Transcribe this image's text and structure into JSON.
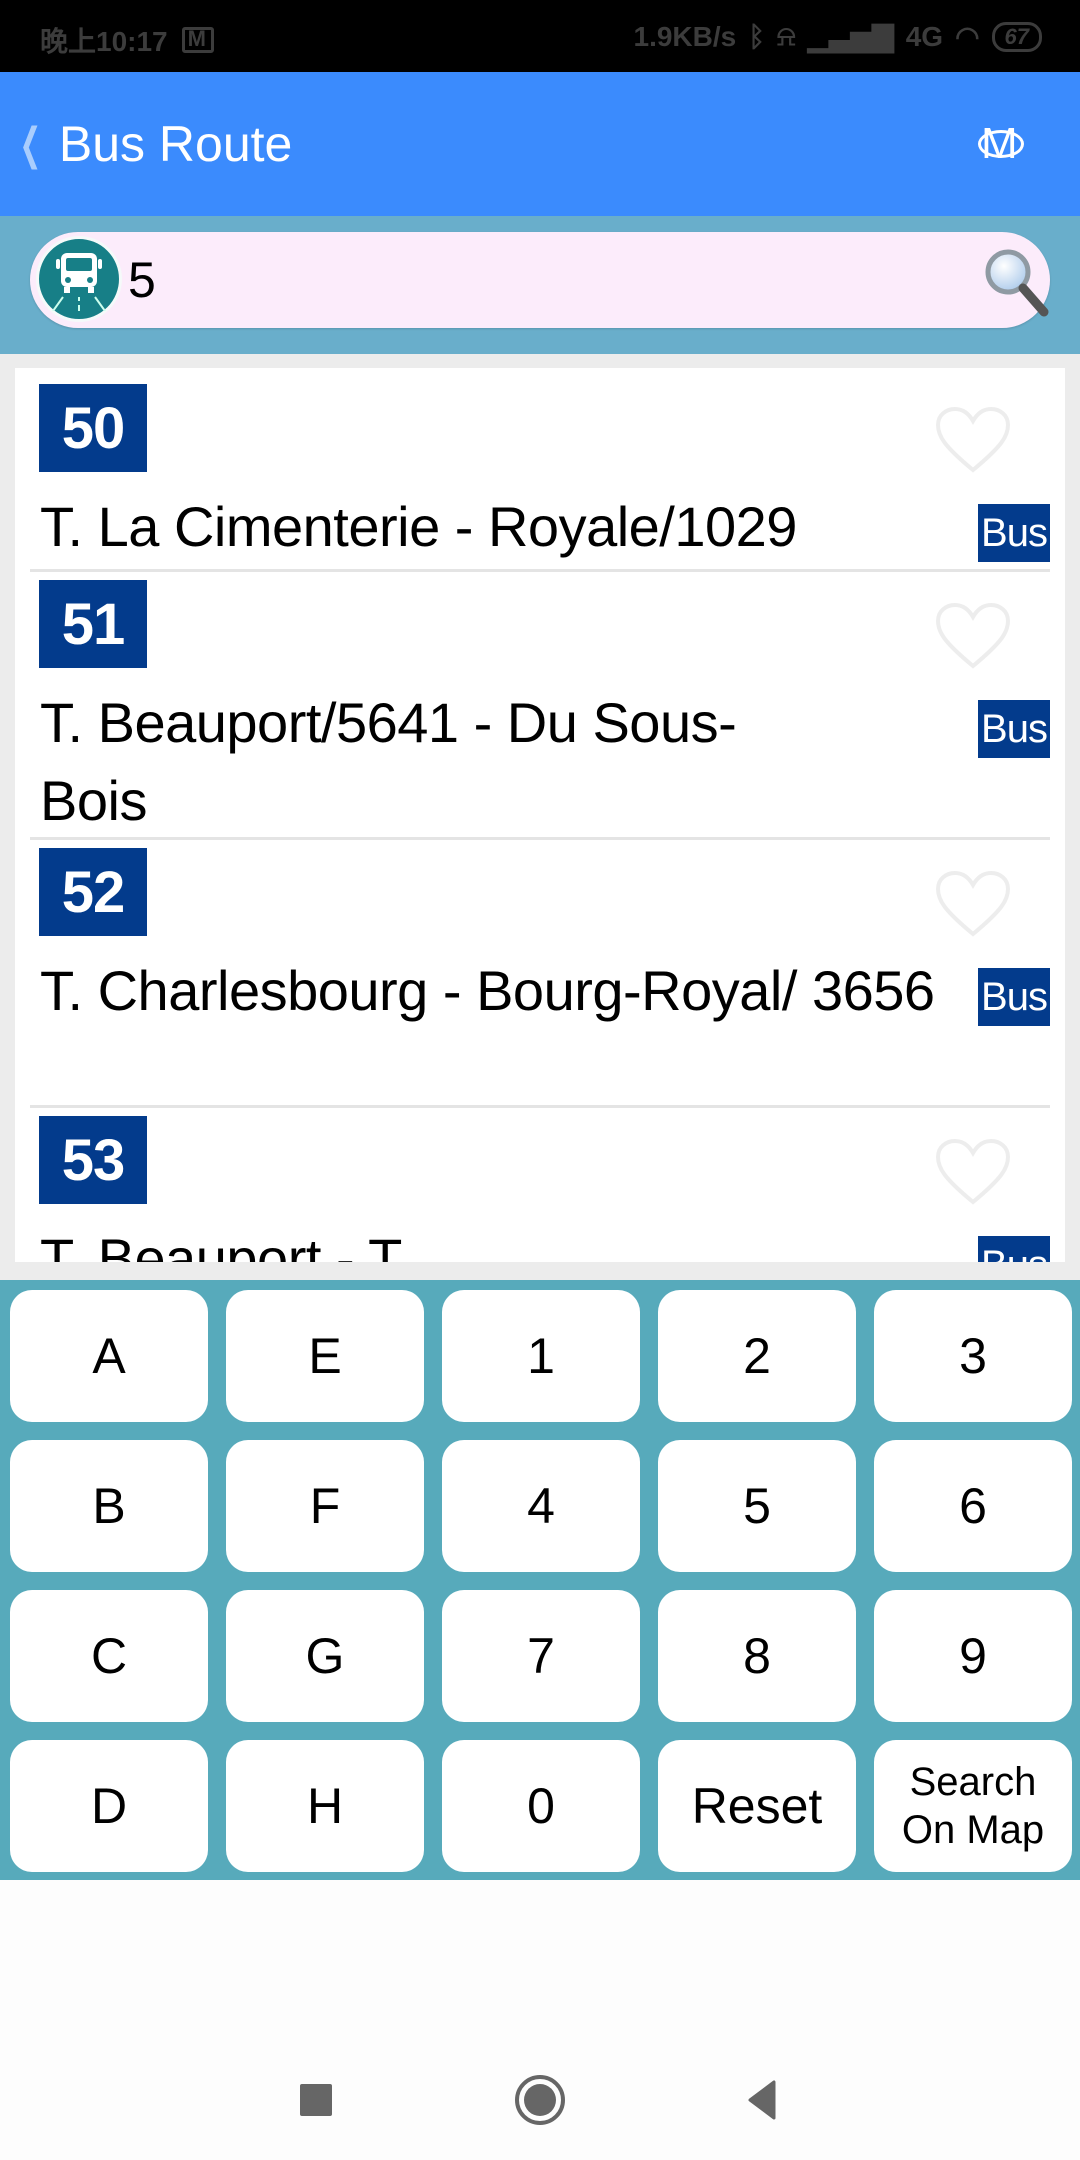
{
  "status_bar": {
    "time": "晚上10:17",
    "net_speed": "1.9KB/s",
    "network": "4G",
    "battery": "67"
  },
  "header": {
    "title": "Bus Route",
    "back_icon": "chevron-left-icon",
    "right_icon": "metro-logo-icon"
  },
  "search": {
    "value": "5",
    "placeholder": "",
    "left_icon": "bus-icon",
    "right_icon": "search-icon"
  },
  "routes": [
    {
      "number": "50",
      "name": "T. La Cimenterie - Royale/1029",
      "type": "Bus"
    },
    {
      "number": "51",
      "name": "T. Beauport/5641 - Du Sous-Bois",
      "type": "Bus"
    },
    {
      "number": "52",
      "name": "T. Charlesbourg - Bourg-Royal/ 3656",
      "type": "Bus"
    },
    {
      "number": "53",
      "name": "T. Beauport - T.",
      "type": "Bus"
    }
  ],
  "keypad": {
    "rows": [
      [
        "A",
        "E",
        "1",
        "2",
        "3"
      ],
      [
        "B",
        "F",
        "4",
        "5",
        "6"
      ],
      [
        "C",
        "G",
        "7",
        "8",
        "9"
      ],
      [
        "D",
        "H",
        "0",
        "Reset",
        "Search On Map"
      ]
    ]
  },
  "nav": {
    "recents": "recents-icon",
    "home": "home-icon",
    "back": "back-icon"
  },
  "colors": {
    "header_bg": "#3b8bfd",
    "search_band_bg": "#69aecb",
    "route_badge_bg": "#033b8c",
    "keypad_bg": "#57aabb"
  }
}
